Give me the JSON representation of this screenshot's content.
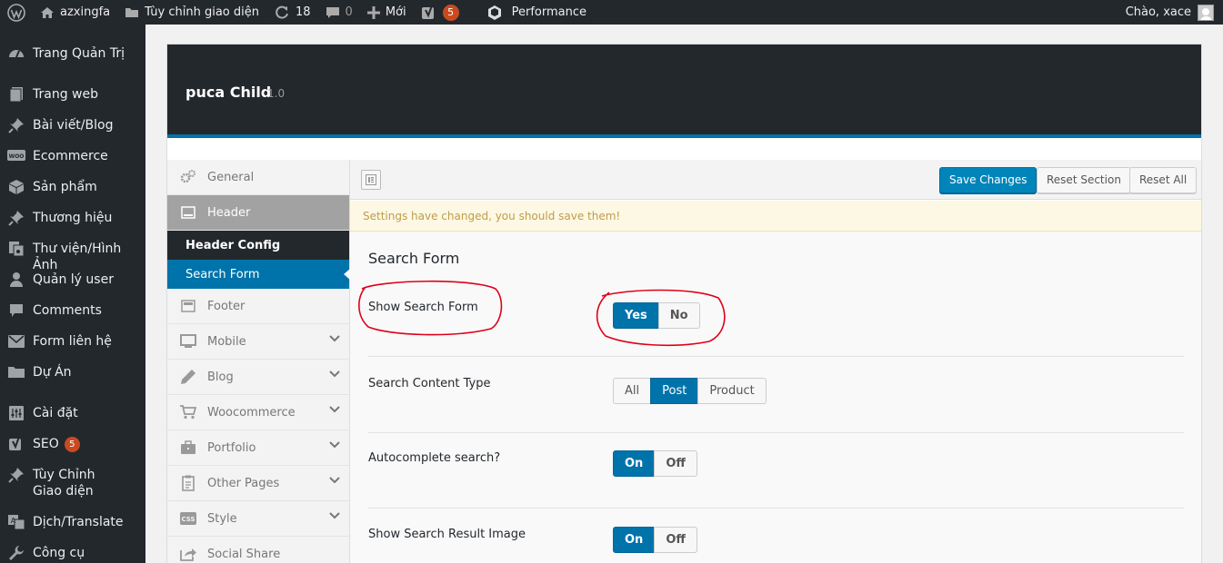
{
  "adminbar": {
    "site_name": "azxingfa",
    "customize": "Tùy chỉnh giao diện",
    "updates_count": "18",
    "comments_count": "0",
    "new_label": "Mới",
    "yoast_badge": "5",
    "performance": "Performance",
    "greeting": "Chào, xace"
  },
  "menu": {
    "items": [
      {
        "label": "Trang Quản Trị",
        "icon": "dashboard-icon"
      },
      {
        "label": "Trang web",
        "icon": "pages-icon"
      },
      {
        "label": "Bài viết/Blog",
        "icon": "pin-icon"
      },
      {
        "label": "Ecommerce",
        "icon": "woo-icon"
      },
      {
        "label": "Sản phẩm",
        "icon": "box-icon"
      },
      {
        "label": "Thương hiệu",
        "icon": "pin-icon"
      },
      {
        "label": "Thư viện/Hình Ảnh",
        "icon": "media-icon"
      },
      {
        "label": "Quản lý user",
        "icon": "user-icon"
      },
      {
        "label": "Comments",
        "icon": "comment-icon"
      },
      {
        "label": "Form liên hệ",
        "icon": "mail-icon"
      },
      {
        "label": "Dự Án",
        "icon": "folder-icon"
      },
      {
        "label": "Cài đặt",
        "icon": "settings-icon"
      },
      {
        "label": "SEO",
        "icon": "yoast-icon",
        "badge": "5"
      },
      {
        "label": "Tùy Chỉnh Giao diện",
        "icon": "brush-icon"
      },
      {
        "label": "Dịch/Translate",
        "icon": "translate-icon"
      },
      {
        "label": "Công cụ",
        "icon": "wrench-icon"
      }
    ]
  },
  "panel": {
    "theme_name": "puca Child",
    "version": "1.0",
    "sidebar": {
      "general": "General",
      "header": "Header",
      "header_config": "Header Config",
      "search_form": "Search Form",
      "footer": "Footer",
      "mobile": "Mobile",
      "blog": "Blog",
      "woocommerce": "Woocommerce",
      "portfolio": "Portfolio",
      "other_pages": "Other Pages",
      "style": "Style",
      "social_share": "Social Share"
    },
    "toolbar": {
      "save": "Save Changes",
      "reset_section": "Reset Section",
      "reset_all": "Reset All"
    },
    "notice": "Settings have changed, you should save them!",
    "section_title": "Search Form",
    "fields": {
      "show_search_form": {
        "label": "Show Search Form",
        "options": [
          "Yes",
          "No"
        ],
        "selected": "Yes"
      },
      "search_content_type": {
        "label": "Search Content Type",
        "options": [
          "All",
          "Post",
          "Product"
        ],
        "selected": "Post"
      },
      "autocomplete": {
        "label": "Autocomplete search?",
        "options": [
          "On",
          "Off"
        ],
        "selected": "On"
      },
      "show_result_image": {
        "label": "Show Search Result Image",
        "options": [
          "On",
          "Off"
        ],
        "selected": "On"
      }
    }
  },
  "colors": {
    "admin_dark": "#23282d",
    "accent_blue": "#0073aa",
    "badge_orange": "#ca4a1f",
    "annotation_red": "#e0001a"
  }
}
